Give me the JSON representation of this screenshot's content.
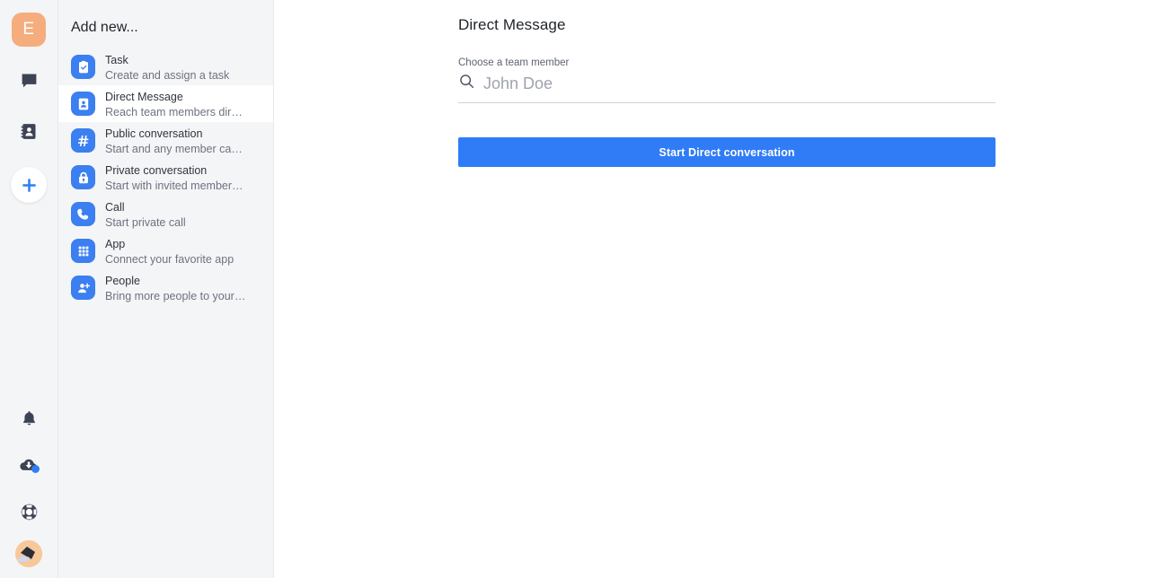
{
  "rail": {
    "workspace": {
      "initial": "E",
      "color": "#f5ad7e"
    },
    "top_items": [
      {
        "name": "chat-icon",
        "label": "Chat"
      },
      {
        "name": "contacts-icon",
        "label": "Contacts"
      },
      {
        "name": "create-new-icon",
        "label": "Create new"
      }
    ],
    "bottom_items": [
      {
        "name": "bell-icon",
        "label": "Notifications"
      },
      {
        "name": "cloud-download-icon",
        "label": "Install app",
        "badge": true
      },
      {
        "name": "lifebuoy-icon",
        "label": "Help"
      },
      {
        "name": "user-avatar",
        "label": "My account"
      }
    ]
  },
  "panel": {
    "title": "Add new...",
    "items": [
      {
        "icon": "clipboard-check-icon",
        "title": "Task",
        "subtitle": "Create and assign a task",
        "selected": false
      },
      {
        "icon": "contact-card-icon",
        "title": "Direct Message",
        "subtitle": "Reach team members directly",
        "selected": true
      },
      {
        "icon": "hash-icon",
        "title": "Public conversation",
        "subtitle": "Start and any member can jo…",
        "selected": false
      },
      {
        "icon": "lock-icon",
        "title": "Private conversation",
        "subtitle": "Start with invited members o…",
        "selected": false
      },
      {
        "icon": "phone-icon",
        "title": "Call",
        "subtitle": "Start private call",
        "selected": false
      },
      {
        "icon": "apps-grid-icon",
        "title": "App",
        "subtitle": "Connect your favorite app",
        "selected": false
      },
      {
        "icon": "person-plus-icon",
        "title": "People",
        "subtitle": "Bring more people to your te…",
        "selected": false
      }
    ]
  },
  "main": {
    "title": "Direct Message",
    "field_label": "Choose a team member",
    "search": {
      "icon": "search-icon",
      "value": "",
      "placeholder": "John Doe"
    },
    "submit_label": "Start Direct conversation"
  },
  "colors": {
    "accent": "#2f7cf6",
    "icon_tile": "#3b7ff0",
    "panel_bg": "#f4f5f7",
    "text_primary": "#2f343d",
    "text_secondary": "#6c727f",
    "avatar_bg": "#f5ad7e"
  }
}
